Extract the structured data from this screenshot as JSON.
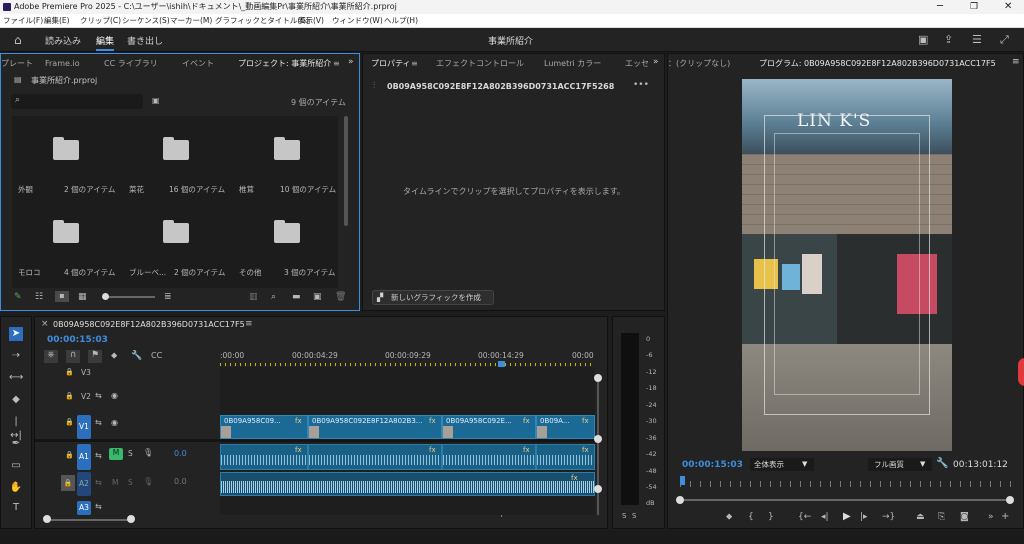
{
  "window": {
    "title": "Adobe Premiere Pro 2025 - C:\\ユーザー\\ishih\\ドキュメント\\_動画編集Pr\\事業所紹介\\事業所紹介.prproj"
  },
  "menu": [
    "ファイル(F)",
    "編集(E)",
    "クリップ(C)",
    "シーケンス(S)",
    "マーカー(M)",
    "グラフィックとタイトル(G)",
    "表示(V)",
    "ウィンドウ(W)",
    "ヘルプ(H)"
  ],
  "workspace": {
    "tabs": [
      "読み込み",
      "編集",
      "書き出し"
    ],
    "title": "事業所紹介"
  },
  "project_panel": {
    "tabs": [
      "プレート",
      "Frame.io",
      "CC ライブラリ",
      "イベント",
      "プロジェクト: 事業所紹介"
    ],
    "file": "事業所紹介.prproj",
    "item_count": "9 個のアイテム",
    "bins": [
      {
        "name": "外観",
        "count": "2 個のアイテム"
      },
      {
        "name": "菜花",
        "count": "16 個のアイテム"
      },
      {
        "name": "椎茸",
        "count": "10 個のアイテム"
      },
      {
        "name": "モロコ",
        "count": "4 個のアイテム"
      },
      {
        "name": "ブルーベ...",
        "count": "2 個のアイテム"
      },
      {
        "name": "その他",
        "count": "3 個のアイテム"
      }
    ]
  },
  "properties_panel": {
    "tabs": [
      "プロパティ",
      "エフェクトコントロール",
      "Lumetri カラー",
      "エッセ"
    ],
    "clip_name": "0B09A958C092E8F12A802B396D0731ACC17F5268",
    "empty_message": "タイムラインでクリップを選択してプロパティを表示します。",
    "new_graphic_button": "新しいグラフィックを作成"
  },
  "program_monitor": {
    "source_tab": "：(クリップなし)",
    "tab": "プログラム: 0B09A958C092E8F12A802B396D0731ACC17F5",
    "sign_text": "LIN K'S",
    "timecode": "00:00:15:03",
    "fit": "全体表示",
    "quality": "フル画質",
    "duration": "00:13:01:12"
  },
  "timeline": {
    "tab": "0B09A958C092E8F12A802B396D0731ACC17F5",
    "timecode": "00:00:15:03",
    "ruler": [
      ":00:00",
      "00:00:04:29",
      "00:00:09:29",
      "00:00:14:29",
      "00:00"
    ],
    "tracks": {
      "v3": "V3",
      "v2": "V2",
      "v1": "V1",
      "a1": "A1",
      "a2": "A2",
      "a3": "A3",
      "m": "M",
      "s": "S",
      "vol1": "0.0",
      "vol2": "0.0"
    },
    "clips": [
      "0B09A958C09...",
      "0B09A958C092E8F12A802B3...",
      "0B09A958C092E...",
      "0B09A..."
    ],
    "fx": "fx"
  },
  "audio_meter": {
    "scale": [
      "0",
      "-6",
      "-12",
      "-18",
      "-24",
      "-30",
      "-36",
      "-42",
      "-48",
      "-54"
    ],
    "db": "dB",
    "s_left": "S",
    "s_right": "S"
  },
  "colors": {
    "accent": "#3e8ede",
    "clip": "#1b6a96",
    "playhead": "#3e8ede",
    "panel": "#232323"
  }
}
